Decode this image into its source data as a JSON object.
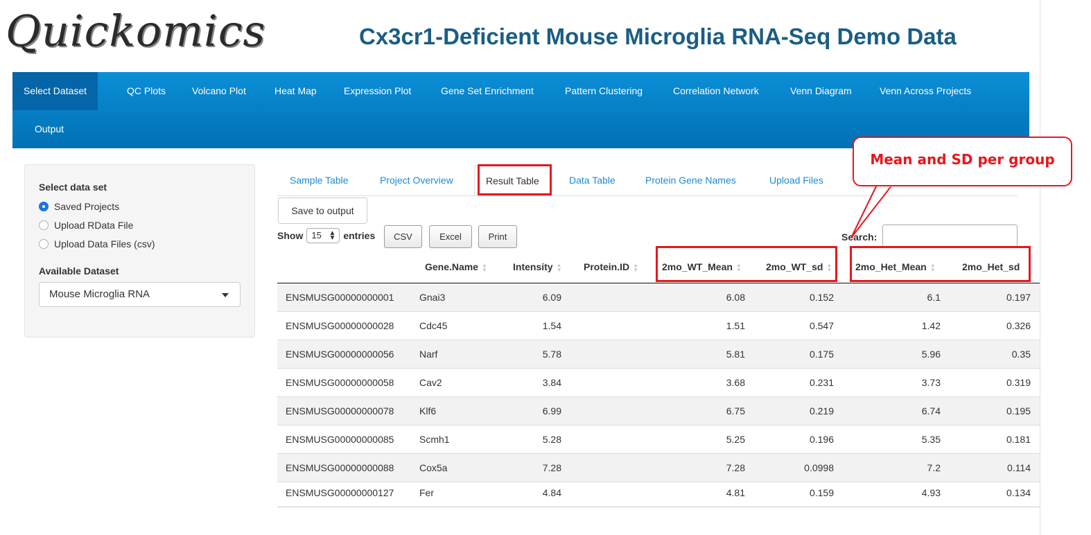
{
  "header": {
    "logo": "Quickomics",
    "title": "Cx3cr1-Deficient Mouse Microglia RNA-Seq Demo Data"
  },
  "nav": {
    "items": [
      "Select Dataset",
      "QC Plots",
      "Volcano Plot",
      "Heat Map",
      "Expression Plot",
      "Gene Set Enrichment",
      "Pattern Clustering",
      "Correlation Network",
      "Venn Diagram",
      "Venn Across Projects",
      "Output"
    ],
    "active": "Select Dataset"
  },
  "sidebar": {
    "select_label": "Select data set",
    "options": [
      "Saved Projects",
      "Upload RData File",
      "Upload Data Files (csv)"
    ],
    "selected_option": "Saved Projects",
    "available_label": "Available Dataset",
    "dataset_value": "Mouse Microglia RNA"
  },
  "tabs": {
    "items": [
      "Sample Table",
      "Project Overview",
      "Result Table",
      "Data Table",
      "Protein Gene Names",
      "Upload Files"
    ],
    "active": "Result Table"
  },
  "controls": {
    "save_label": "Save to output",
    "show_label": "Show",
    "entries_value": "15",
    "entries_label": "entries",
    "csv_label": "CSV",
    "excel_label": "Excel",
    "print_label": "Print",
    "search_label": "Search:",
    "search_value": ""
  },
  "table": {
    "columns": [
      "Gene.Name",
      "Intensity",
      "Protein.ID",
      "2mo_WT_Mean",
      "2mo_WT_sd",
      "2mo_Het_Mean",
      "2mo_Het_sd"
    ],
    "rows": [
      [
        "ENSMUSG00000000001",
        "Gnai3",
        "6.09",
        "",
        "6.08",
        "0.152",
        "6.1",
        "0.197"
      ],
      [
        "ENSMUSG00000000028",
        "Cdc45",
        "1.54",
        "",
        "1.51",
        "0.547",
        "1.42",
        "0.326"
      ],
      [
        "ENSMUSG00000000056",
        "Narf",
        "5.78",
        "",
        "5.81",
        "0.175",
        "5.96",
        "0.35"
      ],
      [
        "ENSMUSG00000000058",
        "Cav2",
        "3.84",
        "",
        "3.68",
        "0.231",
        "3.73",
        "0.319"
      ],
      [
        "ENSMUSG00000000078",
        "Klf6",
        "6.99",
        "",
        "6.75",
        "0.219",
        "6.74",
        "0.195"
      ],
      [
        "ENSMUSG00000000085",
        "Scmh1",
        "5.28",
        "",
        "5.25",
        "0.196",
        "5.35",
        "0.181"
      ],
      [
        "ENSMUSG00000000088",
        "Cox5a",
        "7.28",
        "",
        "7.28",
        "0.0998",
        "7.2",
        "0.114"
      ],
      [
        "ENSMUSG00000000127",
        "Fer",
        "4.84",
        "",
        "4.81",
        "0.159",
        "4.93",
        "0.134"
      ]
    ]
  },
  "annotation": {
    "callout_text": "Mean and SD per group",
    "highlight_color": "#e8161c"
  }
}
